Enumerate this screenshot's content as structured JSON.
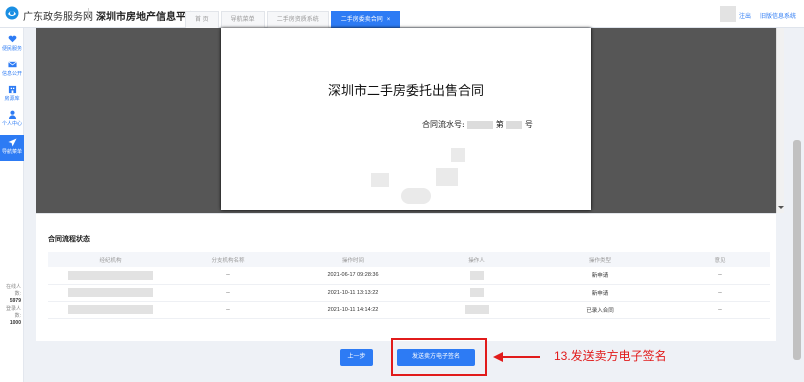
{
  "header": {
    "brand": "广东政务服务网",
    "platform": "深圳市房地产信息平台",
    "tabs": [
      {
        "label": "首 页"
      },
      {
        "label": "导航菜单"
      },
      {
        "label": "二手房资质系统"
      },
      {
        "label": "二手房委卖合同",
        "close": "×"
      }
    ],
    "exit_label": "注出",
    "old_system_label": "旧版信息系统"
  },
  "sidebar": {
    "items": [
      {
        "label": "便民服务",
        "icon": "heart-hand-icon"
      },
      {
        "label": "信息公开",
        "icon": "envelope-icon"
      },
      {
        "label": "房源库",
        "icon": "building-icon"
      },
      {
        "label": "个人中心",
        "icon": "user-icon"
      },
      {
        "label": "导航菜单",
        "icon": "paper-plane-icon"
      }
    ],
    "stats": [
      {
        "label": "在线人数:",
        "value": "5979"
      },
      {
        "label": "登录人数:",
        "value": "1000"
      }
    ]
  },
  "document": {
    "title": "深圳市二手房委托出售合同",
    "serial_prefix": "合同流水号:",
    "serial_mid": "第",
    "serial_suffix": "号"
  },
  "flow": {
    "title": "合同流程状态",
    "columns": [
      "经纪机构",
      "分支机构名称",
      "操作时间",
      "操作人",
      "操作类型",
      "意见"
    ],
    "rows": [
      {
        "branch": "--",
        "time": "2021-06-17 09:28:36",
        "type": "新申请",
        "opinion": "--"
      },
      {
        "branch": "--",
        "time": "2021-10-11 13:13:22",
        "type": "新申请",
        "opinion": "--"
      },
      {
        "branch": "--",
        "time": "2021-10-11 14:14:22",
        "type": "已录入合同",
        "opinion": "--"
      }
    ]
  },
  "actions": {
    "prev_label": "上一步",
    "send_label": "发送卖方电子签名"
  },
  "annotation": {
    "text": "13.发送卖方电子签名",
    "color": "#e11b1b"
  },
  "colors": {
    "accent": "#2d7bf4"
  }
}
